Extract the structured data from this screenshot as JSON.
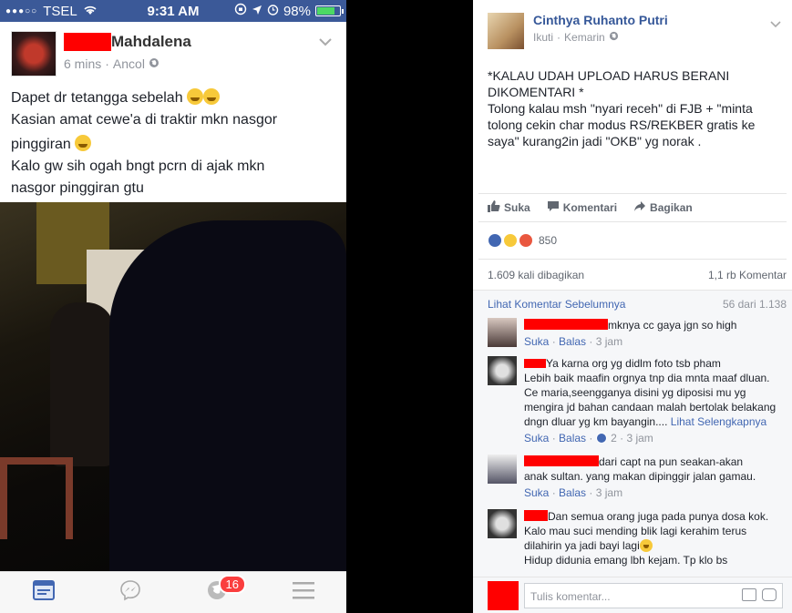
{
  "status_bar": {
    "signal": "●●●○○",
    "carrier": "TSEL",
    "time": "9:31 AM",
    "battery": "98%"
  },
  "post": {
    "author_suffix": "Mahdalena",
    "time": "6 mins",
    "sep": "·",
    "location": "Ancol",
    "lines": [
      "Dapet dr tetangga sebelah",
      "Kasian amat cewe'a di traktir mkn nasgor",
      "pinggiran",
      "Kalo gw sih ogah bngt pcrn di ajak mkn",
      "nasgor pinggiran gtu"
    ]
  },
  "tabbar": {
    "notification_count": "16"
  },
  "panel": {
    "author": "Cinthya Ruhanto Putri",
    "follow": "Ikuti",
    "sep": "·",
    "time": "Kemarin",
    "text_line1": "*KALAU UDAH UPLOAD HARUS BERANI",
    "text_line2": "DIKOMENTARI *",
    "text_body": "Tolong kalau msh \"nyari receh\" di FJB + \"minta tolong cekin char modus RS/REKBER gratis ke saya\" kurang2in jadi \"OKB\" yg norak .",
    "actions": {
      "like": "Suka",
      "comment": "Komentari",
      "share": "Bagikan"
    },
    "reaction_count": "850",
    "shares": "1.609 kali dibagikan",
    "comments_count": "1,1 rb Komentar",
    "view_previous": "Lihat Komentar Sebelumnya",
    "pager": "56 dari 1.138",
    "comments": [
      {
        "text": "mknya cc gaya jgn so high",
        "like": "Suka",
        "reply": "Balas",
        "time": "3 jam"
      },
      {
        "text_first": "Ya karna org yg didlm foto tsb pham",
        "text_rest": "Lebih baik maafin orgnya tnp dia mnta maaf dluan. Ce maria,seengganya disini yg diposisi mu yg mengira jd bahan candaan malah bertolak belakang dngn dluar yg km bayangin....",
        "see_more": "Lihat Selengkapnya",
        "like": "Suka",
        "reply": "Balas",
        "likes": "2",
        "time": "3 jam"
      },
      {
        "text_first": "dari capt na pun seakan-akan",
        "text_rest": "anak sultan. yang makan dipinggir jalan gamau.",
        "like": "Suka",
        "reply": "Balas",
        "time": "3 jam"
      },
      {
        "text_first": "Dan semua orang juga pada punya dosa kok.",
        "text_rest": "Kalo mau suci mending blik lagi kerahim terus dilahirin ya jadi bayi lagi",
        "text_cut": "Hidup didunia emang lbh kejam. Tp klo bs"
      }
    ],
    "composer_placeholder": "Tulis komentar..."
  }
}
